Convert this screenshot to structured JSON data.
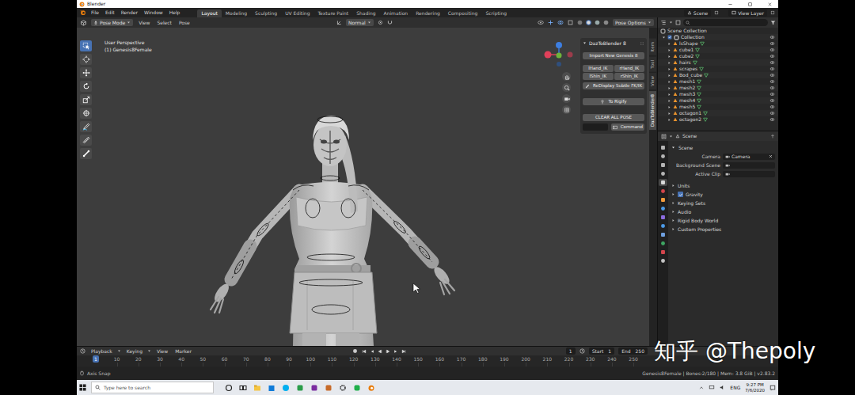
{
  "window": {
    "title": "Blender"
  },
  "menu": [
    "File",
    "Edit",
    "Render",
    "Window",
    "Help"
  ],
  "workspaces": [
    {
      "label": "Layout",
      "selected": true
    },
    {
      "label": "Modeling",
      "selected": false
    },
    {
      "label": "Sculpting",
      "selected": false
    },
    {
      "label": "UV Editing",
      "selected": false
    },
    {
      "label": "Texture Paint",
      "selected": false
    },
    {
      "label": "Shading",
      "selected": false
    },
    {
      "label": "Animation",
      "selected": false
    },
    {
      "label": "Rendering",
      "selected": false
    },
    {
      "label": "Compositing",
      "selected": false
    },
    {
      "label": "Scripting",
      "selected": false
    }
  ],
  "scene": "Scene",
  "view_layer": "View Layer",
  "viewport_header": {
    "mode": "Pose Mode",
    "menus": [
      "View",
      "Select",
      "Pose"
    ],
    "orientation": "Normal",
    "options": "Pose Options"
  },
  "viewport": {
    "perspective": "User Perspective",
    "object": "(1) Genesis8Female"
  },
  "tools": [
    {
      "selected": true
    },
    {
      "selected": false
    },
    {
      "selected": false
    },
    {
      "selected": false
    },
    {
      "selected": false
    },
    {
      "selected": false
    },
    {
      "selected": false
    },
    {
      "selected": false
    },
    {
      "selected": false
    }
  ],
  "sidebar": {
    "tabs": [
      {
        "label": "Item",
        "selected": false
      },
      {
        "label": "Tool",
        "selected": false
      },
      {
        "label": "View",
        "selected": false
      },
      {
        "label": "DazToBlender8",
        "selected": true
      }
    ],
    "panel_title": "DazToBlender 8",
    "import": "Import New Genesis 8",
    "ik_buttons": [
      "lHand_IK",
      "rHand_IK",
      "lShin_IK",
      "rShin_IK"
    ],
    "redisplay": "ReDisplay Subtle FK/IK",
    "rigify": "To Rigify",
    "clear": "CLEAR ALL POSE",
    "command": "Command"
  },
  "outliner": {
    "root": "Scene Collection",
    "collection": "Collection",
    "objects": [
      "lsShape",
      "cube1",
      "cube2",
      "hairs",
      "scrapes",
      "Bod_cube",
      "mesh1",
      "mesh2",
      "mesh3",
      "mesh4",
      "mesh5",
      "octagon1",
      "octagon2"
    ]
  },
  "property_tabs": [
    {
      "selected": false
    },
    {
      "selected": false
    },
    {
      "selected": false
    },
    {
      "selected": false
    },
    {
      "selected": true
    },
    {
      "selected": false
    },
    {
      "selected": false
    },
    {
      "selected": false
    },
    {
      "selected": false
    },
    {
      "selected": false
    },
    {
      "selected": false
    },
    {
      "selected": false
    },
    {
      "selected": false
    },
    {
      "selected": false
    }
  ],
  "properties": {
    "context": "Scene",
    "panel": "Scene",
    "fields": [
      {
        "label": "Camera",
        "value": "Camera"
      },
      {
        "label": "Background Scene",
        "value": ""
      },
      {
        "label": "Active Clip",
        "value": ""
      }
    ],
    "sections": [
      {
        "label": "Units",
        "kind": "plain"
      },
      {
        "label": "Gravity",
        "kind": "checkbox",
        "checked": true
      },
      {
        "label": "Keying Sets",
        "kind": "plain"
      },
      {
        "label": "Audio",
        "kind": "plain"
      },
      {
        "label": "Rigid Body World",
        "kind": "plain"
      },
      {
        "label": "Custom Properties",
        "kind": "plain"
      }
    ]
  },
  "timeline": {
    "menus": [
      "Playback",
      "Keying",
      "View",
      "Marker"
    ],
    "frame": "1",
    "start_label": "Start",
    "start": "1",
    "end_label": "End",
    "end": "250",
    "ticks": [
      "10",
      "20",
      "30",
      "40",
      "50",
      "60",
      "70",
      "80",
      "90",
      "100",
      "110",
      "120",
      "130",
      "140",
      "150",
      "160",
      "170",
      "180",
      "190",
      "200",
      "210",
      "220",
      "230",
      "240",
      "250"
    ]
  },
  "status": {
    "left": "Axis Snap",
    "right": "Genesis8Female | Bones:2/180 | Mem: 3.8 GiB | v2.83.2"
  },
  "taskbar": {
    "search": "Type here to search",
    "language": "ENG",
    "time": "9:27 PM",
    "date": "7/6/2020"
  },
  "watermark": "知乎 @Thepoly"
}
